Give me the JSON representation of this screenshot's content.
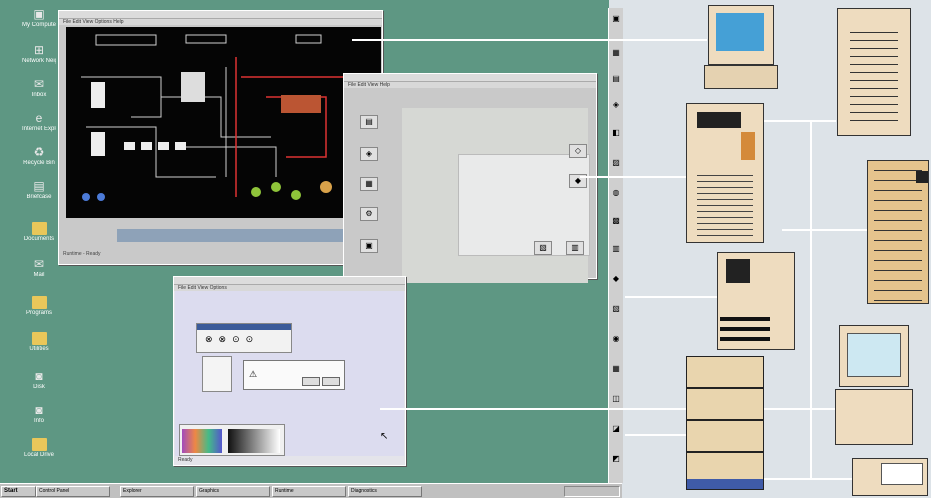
{
  "desktop": {
    "icons": [
      {
        "label": "My Computer",
        "glyph": "▣"
      },
      {
        "label": "Network Neighborhood",
        "glyph": "⊞"
      },
      {
        "label": "Inbox",
        "glyph": "✉"
      },
      {
        "label": "Internet Explorer",
        "glyph": "e"
      },
      {
        "label": "Recycle Bin",
        "glyph": "♻"
      },
      {
        "label": "Briefcase",
        "glyph": "▤"
      },
      {
        "label": "Documents",
        "glyph": ""
      },
      {
        "label": "Mail",
        "glyph": "✉"
      },
      {
        "label": "Programs",
        "glyph": ""
      },
      {
        "label": "Utilities",
        "glyph": ""
      },
      {
        "label": "Disk",
        "glyph": "◙"
      },
      {
        "label": "Info",
        "glyph": "◙"
      },
      {
        "label": "Local Drive",
        "glyph": ""
      }
    ]
  },
  "windows": {
    "plant": {
      "title": "",
      "menu": "File  Edit  View  Options  Help",
      "status": "Runtime - Ready"
    },
    "dialog": {
      "title": "",
      "menu": "File  Edit  View  Help"
    },
    "editor": {
      "title": "",
      "menu": "File  Edit  View  Options",
      "status": "Ready"
    }
  },
  "taskbar": {
    "start_label": "Start",
    "items": [
      "Control Panel",
      "Explorer",
      "Graphics",
      "Runtime",
      "Diagnostics"
    ],
    "clock": ""
  },
  "colors": {
    "desktop": "#5e9783",
    "plant_background": "#050505",
    "device_beige": "#eedcbf",
    "connector": "#ffffff"
  }
}
